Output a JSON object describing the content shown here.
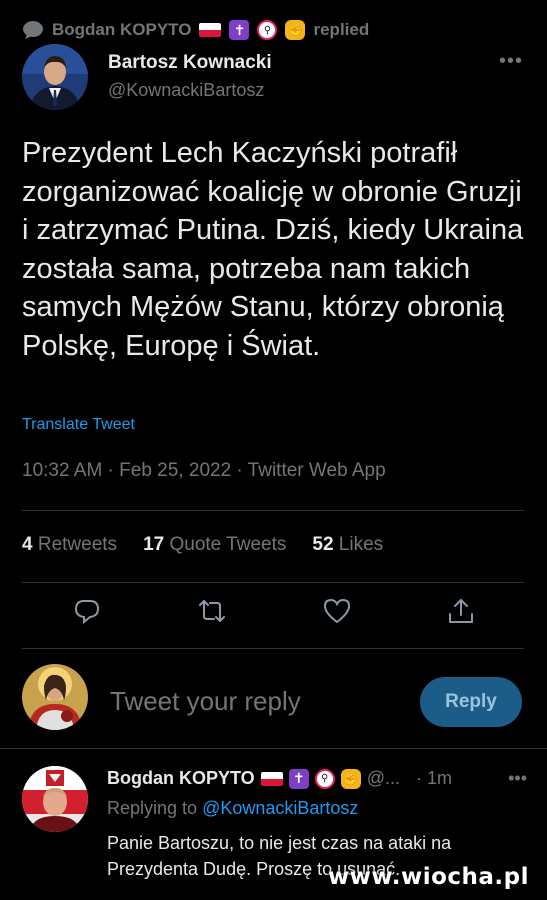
{
  "replied_banner": {
    "user": "Bogdan KOPYTO",
    "action": "replied"
  },
  "tweet": {
    "author_name": "Bartosz Kownacki",
    "author_handle": "@KownackiBartosz",
    "text": "Prezydent Lech Kaczyński potrafił zorganizować koalicję w obronie Gruzji i zatrzymać Putina. Dziś, kiedy Ukraina została sama, potrzeba nam takich samych Mężów Stanu, którzy obronią Polskę, Europę i Świat.",
    "translate_label": "Translate Tweet",
    "meta": "10:32 AM · Feb 25, 2022 · Twitter Web App",
    "stats": {
      "retweets_count": "4",
      "retweets_label": "Retweets",
      "quotes_count": "17",
      "quotes_label": "Quote Tweets",
      "likes_count": "52",
      "likes_label": "Likes"
    },
    "more_icon": "more-dots-icon"
  },
  "actions": [
    "reply-icon",
    "retweet-icon",
    "like-icon",
    "share-icon"
  ],
  "composer": {
    "placeholder": "Tweet your reply",
    "reply_button": "Reply"
  },
  "reply": {
    "author_name": "Bogdan KOPYTO",
    "handle_truncated": "@...",
    "time": "· 1m",
    "replying_prefix": "Replying to",
    "replying_handle": "@KownackiBartosz",
    "text": "Panie Bartoszu, to nie jest czas na ataki na Prezydenta Dudę. Proszę to usunąć."
  },
  "watermark": "www.wiocha.pl",
  "colors": {
    "background": "#000000",
    "accent": "#1d9bf0",
    "muted": "#71767b",
    "reply_button": "#1b5c88"
  }
}
